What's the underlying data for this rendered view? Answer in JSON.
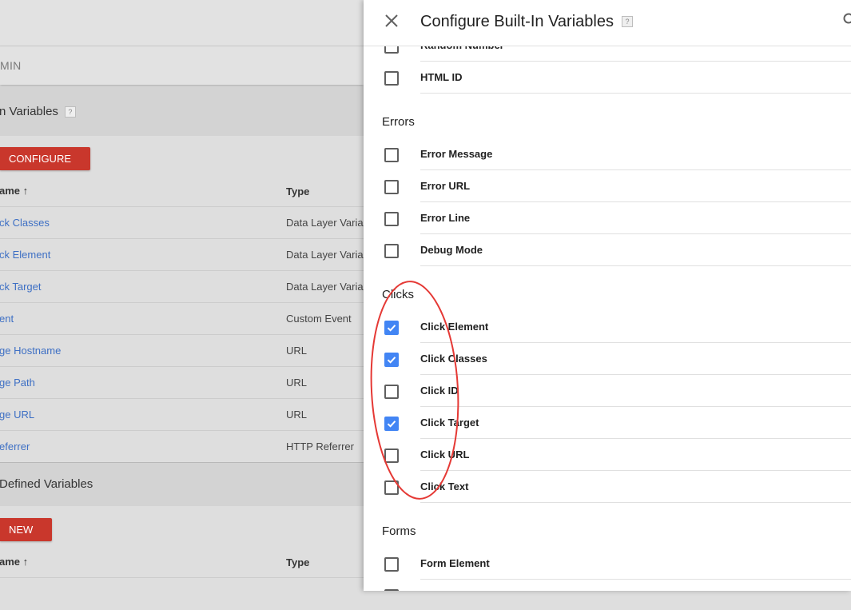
{
  "background": {
    "admin_label": "MIN",
    "builtin_section": {
      "title": "n Variables",
      "help": "?",
      "button_label": "CONFIGURE",
      "col_name": "ame",
      "sort_arrow": "↑",
      "col_type": "Type",
      "rows": [
        {
          "name": "ck Classes",
          "type": "Data Layer Variab"
        },
        {
          "name": "ck Element",
          "type": "Data Layer Variab"
        },
        {
          "name": "ck Target",
          "type": "Data Layer Variab"
        },
        {
          "name": "ent",
          "type": "Custom Event"
        },
        {
          "name": "ge Hostname",
          "type": "URL"
        },
        {
          "name": "ge Path",
          "type": "URL"
        },
        {
          "name": "ge URL",
          "type": "URL"
        },
        {
          "name": "eferrer",
          "type": "HTTP Referrer"
        }
      ]
    },
    "user_section": {
      "title": "Defined Variables",
      "button_label": "NEW",
      "col_name": "ame",
      "sort_arrow": "↑",
      "col_type": "Type"
    }
  },
  "drawer": {
    "title": "Configure Built-In Variables",
    "help": "?",
    "top_items": [
      {
        "label": "Random Number",
        "checked": false
      },
      {
        "label": "HTML ID",
        "checked": false
      }
    ],
    "categories": [
      {
        "name": "Errors",
        "items": [
          {
            "label": "Error Message",
            "checked": false
          },
          {
            "label": "Error URL",
            "checked": false
          },
          {
            "label": "Error Line",
            "checked": false
          },
          {
            "label": "Debug Mode",
            "checked": false
          }
        ]
      },
      {
        "name": "Clicks",
        "items": [
          {
            "label": "Click Element",
            "checked": true
          },
          {
            "label": "Click Classes",
            "checked": true
          },
          {
            "label": "Click ID",
            "checked": false
          },
          {
            "label": "Click Target",
            "checked": true
          },
          {
            "label": "Click URL",
            "checked": false
          },
          {
            "label": "Click Text",
            "checked": false
          }
        ]
      },
      {
        "name": "Forms",
        "items": [
          {
            "label": "Form Element",
            "checked": false
          }
        ]
      }
    ]
  },
  "colors": {
    "accent_red": "#c9372c",
    "link_blue": "#3d6fc4",
    "checkbox_blue": "#4285f4",
    "annotation_red": "#e53935"
  },
  "icons": [
    "close-icon",
    "search-icon",
    "help-icon",
    "sort-arrow-icon",
    "checkmark-icon"
  ]
}
